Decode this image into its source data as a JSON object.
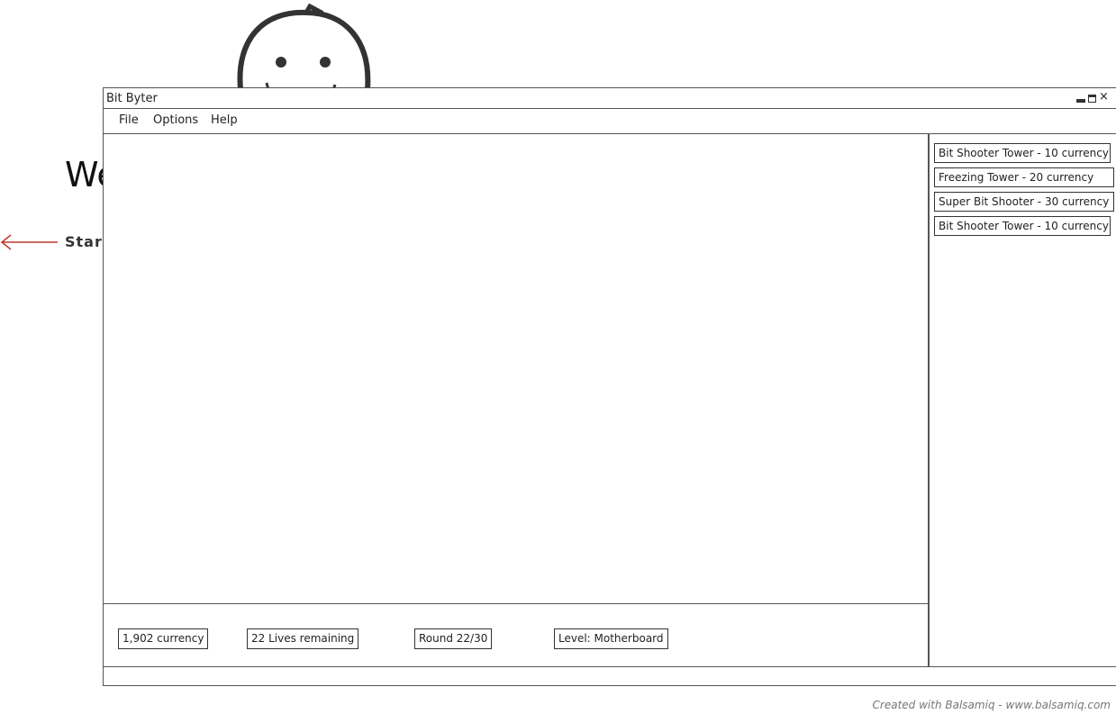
{
  "background": {
    "welcome_text": "We",
    "start_text": "Start"
  },
  "window": {
    "title": "Bit Byter",
    "controls": {
      "minimize": "minimize-icon",
      "maximize": "maximize-icon",
      "close": "×"
    }
  },
  "menu": {
    "items": [
      {
        "label": "File"
      },
      {
        "label": "Options"
      },
      {
        "label": "Help"
      }
    ]
  },
  "tower_shop": {
    "items": [
      {
        "label": "Bit Shooter Tower - 10 currency"
      },
      {
        "label": "Freezing Tower - 20 currency"
      },
      {
        "label": "Super Bit Shooter - 30 currency"
      },
      {
        "label": "Bit Shooter Tower - 10 currency"
      }
    ]
  },
  "status": {
    "currency": "1,902 currency",
    "lives": "22 Lives remaining",
    "round": "Round 22/30",
    "level": "Level: Motherboard"
  },
  "footer": {
    "credit": "Created with Balsamiq - www.balsamiq.com"
  },
  "colors": {
    "arrow": "#c0392b",
    "border": "#555555"
  }
}
